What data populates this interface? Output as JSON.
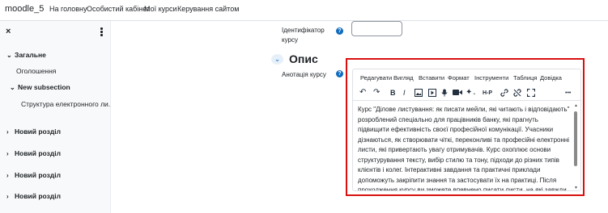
{
  "navbar": {
    "brand": "moodle_5",
    "links": [
      "На головну",
      "Особистий кабінет",
      "Мої курси",
      "Керування сайтом"
    ]
  },
  "drawer": {
    "close_icon": "×",
    "items": [
      {
        "label": "Загальне",
        "expanded": true
      },
      {
        "label": "Оголошення"
      },
      {
        "label": "New subsection",
        "expanded": true
      },
      {
        "label": "Структура електронного ли..."
      },
      {
        "label": "Новий розділ",
        "expanded": false
      },
      {
        "label": "Новий розділ",
        "expanded": false
      },
      {
        "label": "Новий розділ",
        "expanded": false
      },
      {
        "label": "Новий розділ",
        "expanded": false
      }
    ]
  },
  "form": {
    "id_label": "Ідентифікатор курсу",
    "id_value": "",
    "section_title": "Опис",
    "annotation_label": "Анотація курсу"
  },
  "editor": {
    "menu": [
      "Редагувати",
      "Вигляд",
      "Вставити",
      "Формат",
      "Інструменти",
      "Таблиця",
      "Довідка"
    ],
    "toolbar_icons": [
      "undo-icon",
      "redo-icon",
      "bold-icon",
      "italic-icon",
      "image-icon",
      "media-icon",
      "microphone-icon",
      "video-camera-icon",
      "ai-sparkle-icon",
      "h5p-icon",
      "link-icon",
      "unlink-icon",
      "fullscreen-icon",
      "more-icon"
    ],
    "toolbar_text": {
      "bold": "B",
      "italic": "I",
      "h5p": "H-P",
      "more": "•••"
    },
    "content": "Курс \"Ділове листування: як писати мейли, які читають і відповідають\" розроблений спеціально для працівників банку, які прагнуть підвищити ефективність своєї професійної комунікації. Учасники дізнаються, як створювати чіткі, переконливі та професійні електронні листи, які привертають увагу отримувачів. Курс охоплює основи структурування тексту, вибір стилю та тону, підходи до різних типів клієнтів і колег. Інтерактивні завдання та практичні приклади допоможуть закріпити знання та застосувати їх на практиці. Після проходження курсу ви зможете впевнено писати листи, на які завжди отримуватимете"
  },
  "colors": {
    "accent": "#0f6cbf",
    "highlight": "#d9100f"
  }
}
